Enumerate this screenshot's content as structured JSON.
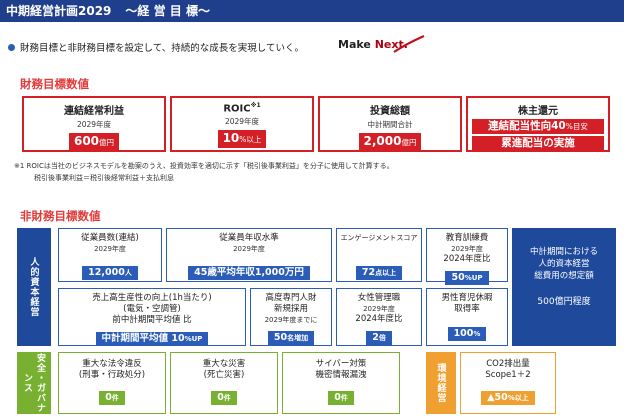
{
  "header": {
    "title": "中期経営計画2029",
    "subtitle": "〜経 営 目 標〜"
  },
  "intro": {
    "text": "財務目標と非財務目標を設定して、持続的な成長を実現していく。",
    "logo_make": "Make",
    "logo_next": "Next."
  },
  "financial": {
    "heading": "財務目標数値",
    "items": [
      {
        "title": "連結経常利益",
        "sub": "2029年度",
        "value": "600",
        "unit": "億円"
      },
      {
        "title": "ROIC",
        "sup": "※1",
        "sub": "2029年度",
        "value": "10",
        "unit": "%以上"
      },
      {
        "title": "投資総額",
        "sub": "中計期間合計",
        "value": "2,000",
        "unit": "億円"
      },
      {
        "title": "株主還元",
        "line1_a": "連結配当性向",
        "line1_b": "40",
        "line1_c": "%目安",
        "line2": "累進配当の実施"
      }
    ],
    "note1": "※1 ROICは当社のビジネスモデルを勘案のうえ、投資効率を適切に示す「税引後事業利益」を分子に使用して計算する。",
    "note2": "税引後事業利益＝税引後経常利益＋支払利息"
  },
  "nonfinancial": {
    "heading": "非財務目標数値",
    "hr_label": "人的資本経営",
    "safety_label": "安全・ガバナンス",
    "env_label": "環境経営",
    "hr": {
      "employees": {
        "title": "従業員数(連結)",
        "sub": "2029年度",
        "value": "12,000",
        "unit": "人"
      },
      "salary": {
        "title": "従業員年収水準",
        "sub": "2029年度",
        "value": "45歳平均年収1,000万円"
      },
      "engagement": {
        "title": "エンゲージメントスコア",
        "value": "72",
        "unit": "点以上"
      },
      "training": {
        "title": "教育訓練費",
        "sub": "2029年度",
        "sub2": "2024年度比",
        "value": "50",
        "unit": "%UP"
      },
      "productivity": {
        "title": "売上高生産性の向上(1h当たり)",
        "sub": "(電気・空調管)",
        "sub2": "前中計期間平均値 比",
        "label": "中計期間平均値",
        "value": "10",
        "unit": "%UP"
      },
      "specialists": {
        "title": "高度専門人財",
        "title2": "新規採用",
        "sub": "2029年度までに",
        "value": "50",
        "unit": "名増加"
      },
      "women": {
        "title": "女性管理職",
        "sub": "2029年度",
        "sub2": "2024年度比",
        "value": "2",
        "unit": "倍"
      },
      "paternity": {
        "title": "男性育児休暇",
        "title2": "取得率",
        "value": "100",
        "unit": "%"
      }
    },
    "side": {
      "l1": "中計期間における",
      "l2": "人的資本経営",
      "l3": "総費用の想定額",
      "value": "500億円程度"
    },
    "safety": {
      "law": {
        "title": "重大な法令違反",
        "sub": "(刑事・行政処分)",
        "value": "0",
        "unit": "件"
      },
      "disaster": {
        "title": "重大な災害",
        "sub": "(死亡災害)",
        "value": "0",
        "unit": "件"
      },
      "cyber": {
        "title": "サイバー対策",
        "sub": "機密情報漏洩",
        "value": "0",
        "unit": "件"
      }
    },
    "env": {
      "title": "CO2排出量",
      "sub": "Scope1＋2",
      "value": "▲50",
      "unit": "%以上"
    }
  },
  "colors": {
    "header": "#1f3e8c",
    "red": "#d41f26",
    "blue": "#2a5cb8",
    "green": "#78b032",
    "orange": "#f0a030"
  }
}
